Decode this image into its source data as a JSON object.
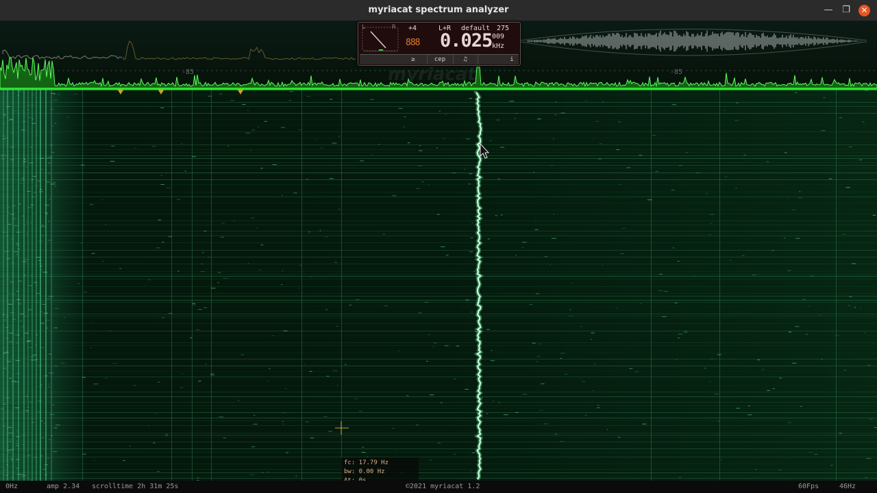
{
  "window": {
    "title": "myriacat spectrum analyzer",
    "controls": {
      "minimize": "—",
      "maximize": "❐",
      "close": "✕"
    }
  },
  "spectrum": {
    "db_markers": [
      "-85",
      "-85"
    ],
    "watermark": "myriacat"
  },
  "meter": {
    "channel_label_left": "L",
    "channel_label_right": "R",
    "gain": "+4",
    "channels": "L+R",
    "preset": "default",
    "preset_count": "275",
    "octave_digits": "888",
    "frequency": "0.025",
    "frequency_fraction": "009",
    "unit": "kHz",
    "buttons": [
      "≥",
      "cep",
      "♫",
      "i"
    ]
  },
  "cursor_readout": {
    "fc": "fc: 17.79 Hz",
    "bw": "bw: 0.00 Hz",
    "dt": "Δt: 0s"
  },
  "status": {
    "freq_min": "0Hz",
    "amp": "amp 2.34",
    "scrolltime": "scrolltime 2h 31m 25s",
    "copyright": "©2021 myriacat 1.2",
    "fps": "60Fps",
    "freq_max": "46Hz"
  },
  "colors": {
    "spectrum_green": "#3dff3d",
    "waterfall_bg": "#051a0e",
    "trace_white": "#f2fff2",
    "marker_gold": "#c9a227",
    "close_button": "#e95420"
  }
}
